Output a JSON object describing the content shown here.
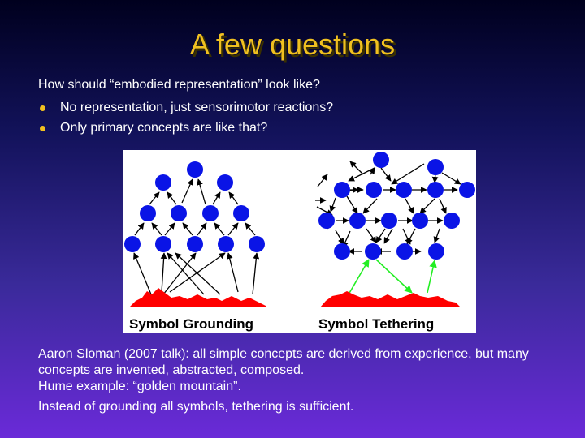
{
  "slide": {
    "title": "A few questions",
    "intro": "How should “embodied representation” look like?",
    "bullets": [
      "No representation, just sensorimotor reactions?",
      "Only primary concepts are like that?"
    ],
    "figure": {
      "left_label": "Symbol Grounding",
      "right_label": "Symbol Tethering",
      "node_color": "#0a14e6",
      "terrain_color": "#ff0000",
      "tether_color": "#22ee22"
    },
    "paragraphs": [
      "Aaron Sloman (2007 talk): all simple concepts are derived from experience, but many concepts are invented, abstracted, composed.",
      "Hume example: “golden mountain”.",
      "Instead of grounding all symbols, tethering is sufficient."
    ],
    "colors": {
      "title": "#f0c020",
      "text": "#ffffff",
      "bullet": "#f0c020"
    }
  }
}
